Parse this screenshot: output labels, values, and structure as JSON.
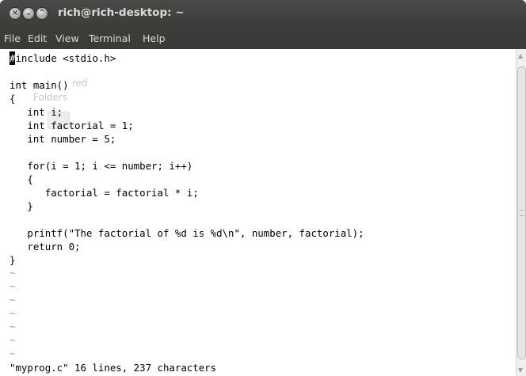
{
  "window": {
    "title": "rich@rich-desktop: ~",
    "controls": {
      "close": "×",
      "minimize": "⌄",
      "maximize": "⌃"
    }
  },
  "menu": [
    "File",
    "Edit",
    "View",
    "Terminal",
    "Help"
  ],
  "editor": {
    "cursor_char": "#",
    "lines": [
      "include <stdio.h>",
      "",
      "int main()",
      "{",
      "   int i;",
      "   int factorial = 1;",
      "   int number = 5;",
      "",
      "   for(i = 1; i <= number; i++)",
      "   {",
      "      factorial = factorial * i;",
      "   }",
      "",
      "   printf(\"The factorial of %d is %d\\n\", number, factorial);",
      "   return 0;",
      "}"
    ],
    "tilde": "~",
    "status": "\"myprog.c\" 16 lines, 237 characters"
  },
  "desktop_ghost": {
    "shared": "red",
    "folders": "Folders"
  },
  "colors": {
    "titlebar": "#3b3b39",
    "menubar": "#3c3b37",
    "menu_text": "#dfdbd2",
    "editor_bg": "#ffffff",
    "tilde": "#9a9a9a"
  }
}
